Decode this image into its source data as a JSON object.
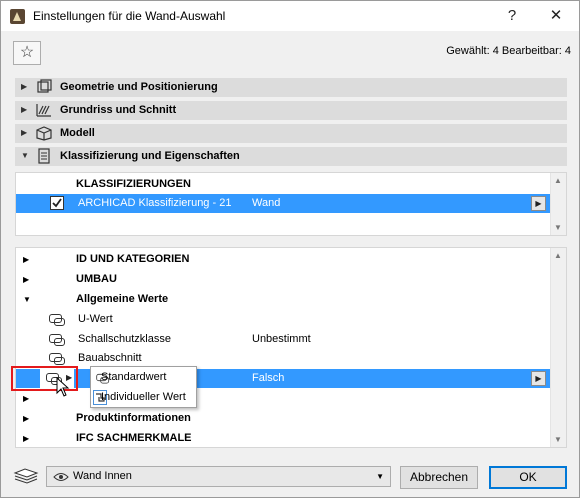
{
  "window": {
    "title": "Einstellungen für die Wand-Auswahl",
    "help_label": "?",
    "close_label": "✕"
  },
  "toolbar": {
    "favorite_label": "☆",
    "selection_info": "Gewählt: 4 Bearbeitbar: 4"
  },
  "sections": [
    {
      "label": "Geometrie und Positionierung",
      "expanded": false
    },
    {
      "label": "Grundriss und Schnitt",
      "expanded": false
    },
    {
      "label": "Modell",
      "expanded": false
    },
    {
      "label": "Klassifizierung und Eigenschaften",
      "expanded": true
    }
  ],
  "classification": {
    "header": "KLASSIFIZIERUNGEN",
    "row_name": "ARCHICAD Klassifizierung - 21",
    "row_value": "Wand"
  },
  "properties": {
    "groups": [
      {
        "label": "ID UND KATEGORIEN"
      },
      {
        "label": "UMBAU"
      },
      {
        "label": "Allgemeine Werte"
      }
    ],
    "items": [
      {
        "name": "U-Wert",
        "value": ""
      },
      {
        "name": "Schallschutzklasse",
        "value": "Unbestimmt"
      },
      {
        "name": "Bauabschnitt",
        "value": ""
      }
    ],
    "selected_value": "Falsch",
    "bottom_groups": [
      {
        "label": "Produktinformationen"
      },
      {
        "label": "IFC SACHMERKMALE"
      }
    ]
  },
  "popup_menu": {
    "items": [
      "Standardwert",
      "Individueller Wert"
    ]
  },
  "footer": {
    "layer_value": "Wand Innen",
    "cancel_label": "Abbrechen",
    "ok_label": "OK"
  },
  "colors": {
    "selection": "#3399ff",
    "highlight_box": "#e31a1c",
    "primary_border": "#0078d7"
  }
}
